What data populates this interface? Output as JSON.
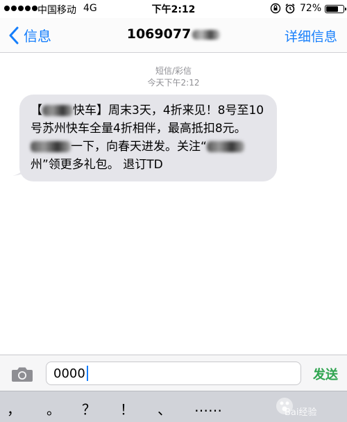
{
  "status_bar": {
    "carrier": "中国移动",
    "network": "4G",
    "time": "下午2:12",
    "battery_percent": "72%",
    "battery_level": 0.72
  },
  "nav": {
    "back_label": "信息",
    "title": "1069077",
    "details_label": "详细信息"
  },
  "conversation": {
    "message_type": "短信/彩信",
    "timestamp": "今天下午2:12"
  },
  "message": {
    "part1": "【",
    "part2": "快车】周末3天，4折来见！8号至10号苏州快车全量4折相伴，最高抵扣8元。",
    "part3": "一下，向春天进发。关注“",
    "part4": "州”领更多礼包。 退订TD"
  },
  "compose": {
    "input_value": "0000",
    "send_label": "发送"
  },
  "keyboard": {
    "keys": [
      "，",
      "。",
      "？",
      "！",
      "、",
      "……"
    ]
  },
  "watermark": {
    "brand": "Bai",
    "suffix": "经验"
  },
  "colors": {
    "ios_blue": "#157efb",
    "send_green": "#2ea44f",
    "bubble_gray": "#e5e5ea"
  }
}
